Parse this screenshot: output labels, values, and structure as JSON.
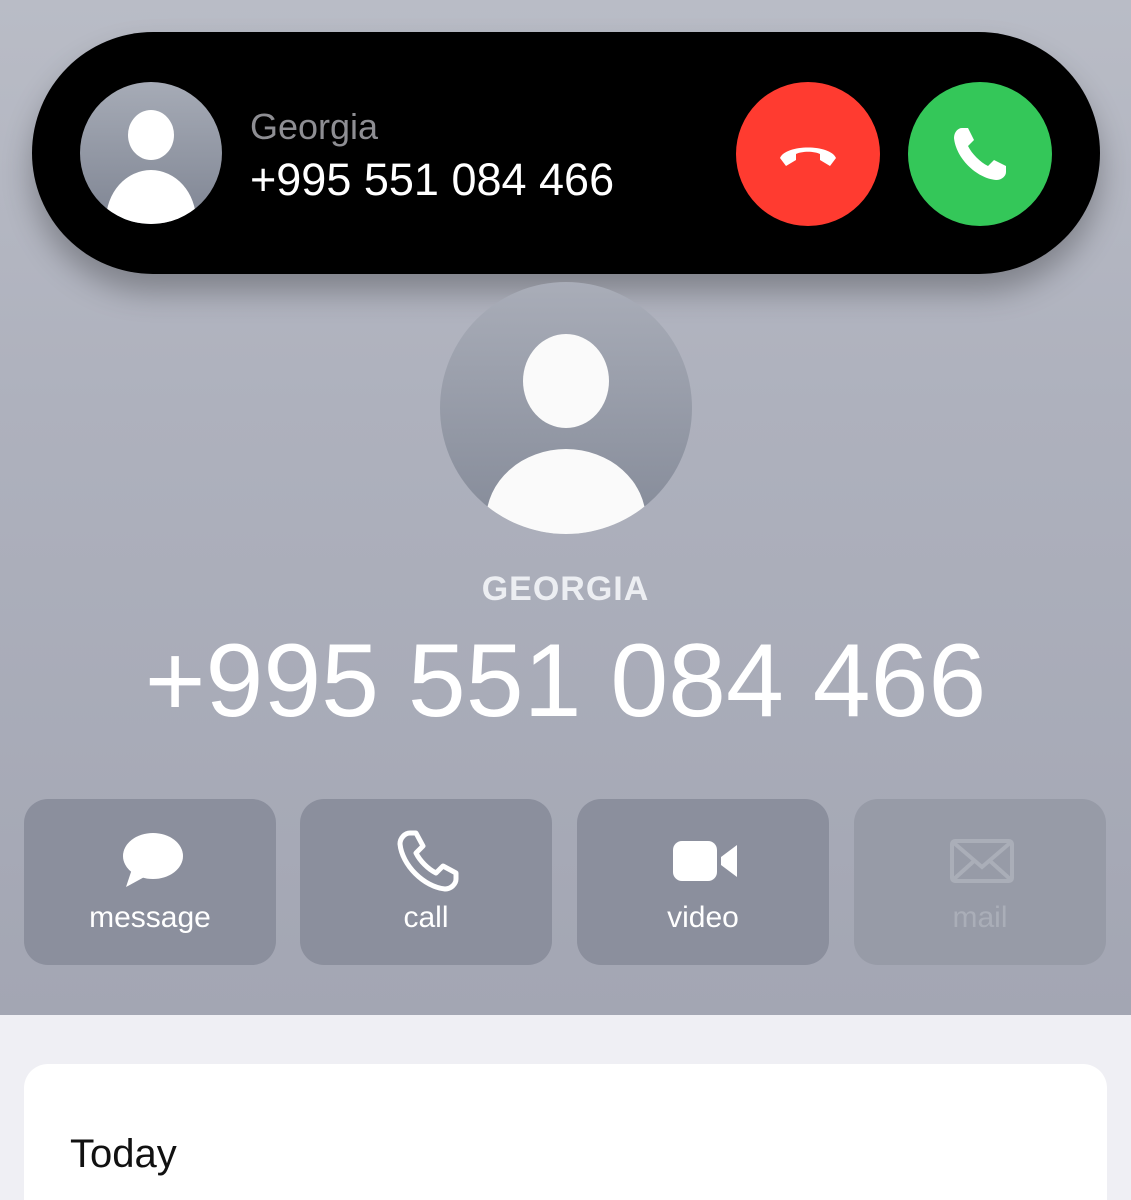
{
  "banner": {
    "label": "Georgia",
    "number": "+995 551 084 466",
    "decline_icon": "phone-hangup-icon",
    "accept_icon": "phone-icon",
    "decline_color": "#ff3b30",
    "accept_color": "#34c759"
  },
  "contact": {
    "label": "GEORGIA",
    "number": "+995 551 084 466",
    "avatar_icon": "person-silhouette-icon"
  },
  "actions": [
    {
      "label": "message",
      "icon": "speech-bubble-icon",
      "enabled": true
    },
    {
      "label": "call",
      "icon": "phone-icon",
      "enabled": true
    },
    {
      "label": "video",
      "icon": "video-camera-icon",
      "enabled": true
    },
    {
      "label": "mail",
      "icon": "envelope-icon",
      "enabled": false
    }
  ],
  "history": {
    "title": "Today"
  }
}
